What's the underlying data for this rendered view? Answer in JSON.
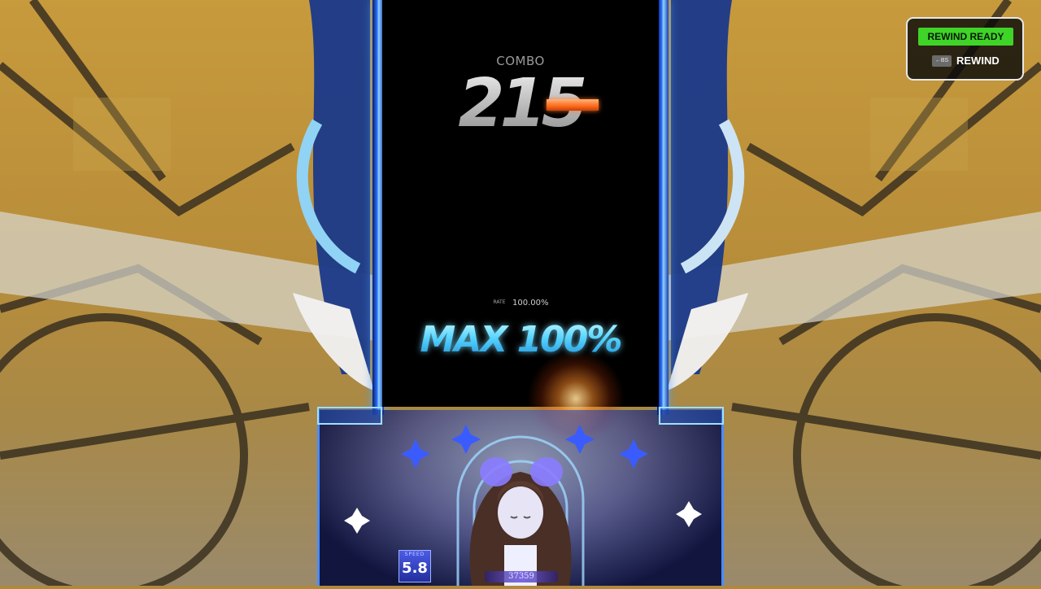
{
  "hud": {
    "combo_label": "COMBO",
    "combo_value": "215",
    "rate_label": "RATE",
    "rate_value": "100.00%",
    "judgement": "MAX 100%",
    "speed_label": "SPEED",
    "speed_value": "5.8",
    "score": "37359"
  },
  "rewind": {
    "status": "REWIND READY",
    "key_hint": "←BS",
    "action_label": "REWIND"
  },
  "colors": {
    "lane_frame": "#2a6dff",
    "judgement_text": "#58d5ff",
    "rewind_ready_bg": "#3fd428",
    "combo_bar": "#ff6a1a"
  },
  "icons": {
    "decor_left": "ornate-wing-frame",
    "decor_right": "ornate-wing-frame",
    "sparkle": "four-point-star",
    "character": "singer-girl"
  }
}
